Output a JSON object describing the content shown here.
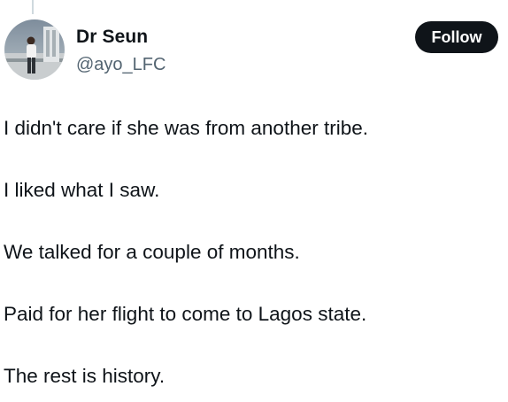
{
  "author": {
    "display_name": "Dr Seun",
    "handle": "@ayo_LFC",
    "avatar_icon": "profile-photo"
  },
  "follow_button": {
    "label": "Follow"
  },
  "tweet": {
    "paragraphs": [
      "I didn't care if she was from another tribe.",
      "I liked what I saw.",
      "We talked for a couple of months.",
      "Paid for her flight to come to Lagos state.",
      "The rest is history."
    ]
  },
  "colors": {
    "text": "#0f1419",
    "secondary_text": "#536471",
    "button_bg": "#0f1419",
    "button_text": "#ffffff",
    "thread_line": "#cfd9de"
  }
}
